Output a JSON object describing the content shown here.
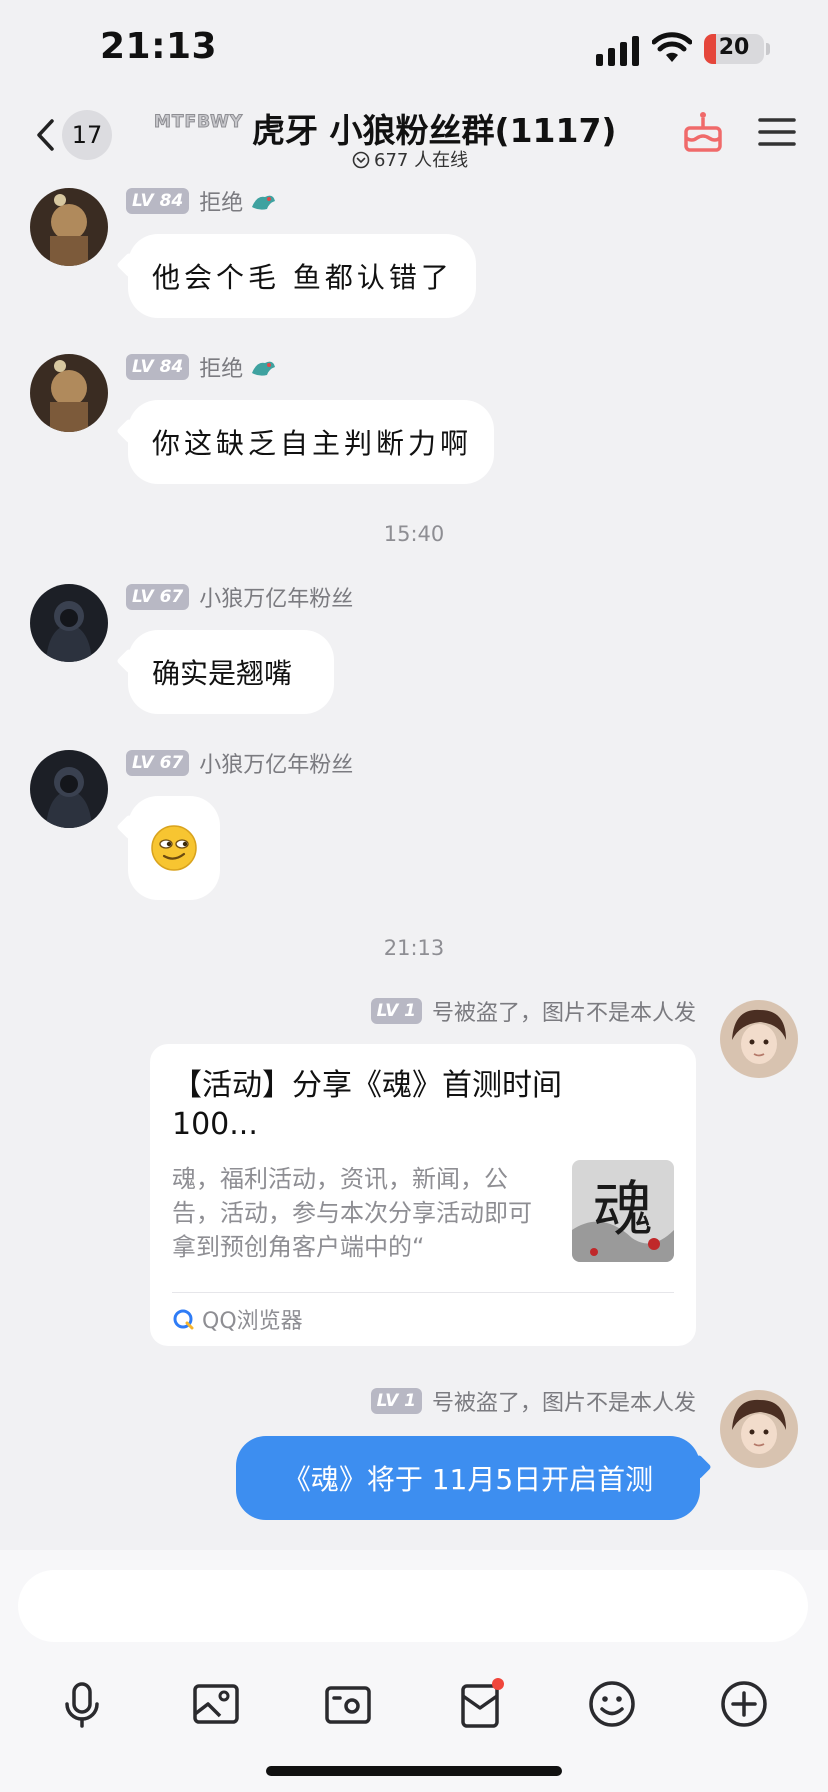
{
  "status_bar": {
    "time": "21:13",
    "battery": "20",
    "battery_level_percent": 20
  },
  "header": {
    "back_count": "17",
    "group_badge": "MTFBWY",
    "title": "虎牙 小狼粉丝群(1117)",
    "online": "677 人在线"
  },
  "messages": [
    {
      "level": "LV 84",
      "sender": "拒绝",
      "text": "他会个毛 鱼都认错了"
    },
    {
      "level": "LV 84",
      "sender": "拒绝",
      "text": "你这缺乏自主判断力啊"
    },
    {
      "level": "LV 67",
      "sender": "小狼万亿年粉丝",
      "text": "确实是翘嘴"
    },
    {
      "level": "LV 67",
      "sender": "小狼万亿年粉丝",
      "emoji": "smirk-emoji"
    }
  ],
  "time_dividers": [
    "15:40",
    "21:13"
  ],
  "own_messages": [
    {
      "level": "LV 1",
      "sender": "号被盗了，图片不是本人发",
      "card": {
        "title": "【活动】分享《魂》首测时间100...",
        "description": "魂，福利活动，资讯，新闻，公告，活动，参与本次分享活动即可拿到预创角客户端中的“",
        "thumbnail_text": "魂",
        "source": "QQ浏览器"
      }
    },
    {
      "level": "LV 1",
      "sender": "号被盗了，图片不是本人发",
      "text": "《魂》将于 11月5日开启首测"
    }
  ],
  "input": {
    "placeholder": ""
  },
  "toolbar": [
    "microphone-icon",
    "image-icon",
    "camera-icon",
    "red-packet-icon",
    "emoji-icon",
    "plus-icon"
  ],
  "colors": {
    "accent": "#3d8ef0",
    "battery": "#e5463b",
    "background": "#f1f1f3"
  }
}
